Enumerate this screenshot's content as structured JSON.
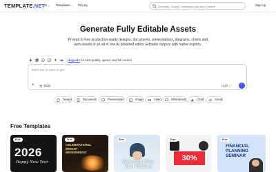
{
  "nav": {
    "logo": "TEMPLATE",
    "logo_suffix": ".NET",
    "ai_label": "AI",
    "templates_label": "Templates",
    "pricing_label": "Pricing",
    "search_placeholder": "Generate, Search Templates with your Content",
    "signup_label": "Sign up"
  },
  "hero": {
    "title": "Generate Fully Editable Assets",
    "subtitle": "Prompt to free production-ready designs, documents, presentations, diagrams, charts and web assets in an all in one AI powered editor. Editable outputs with native exports."
  },
  "prompt": {
    "upgrade_link": "Upgrade",
    "upgrade_text": " for best quality, speed, and full control",
    "placeholder": "Enter text or voice to gen",
    "add_label": "+",
    "tools_label": "Tools",
    "mode_label": "Light ⌄",
    "send_icon": "↑"
  },
  "chips": [
    {
      "label": "Design",
      "icon": "palette-icon"
    },
    {
      "label": "Document",
      "icon": "document-icon"
    },
    {
      "label": "Presentation",
      "icon": "presentation-icon"
    },
    {
      "label": "Image",
      "icon": "image-icon"
    },
    {
      "label": "Video",
      "icon": "video-icon"
    },
    {
      "label": "Whiteboard",
      "icon": "whiteboard-icon"
    },
    {
      "label": "Chart",
      "icon": "chart-icon"
    },
    {
      "label": "Social",
      "icon": "social-icon"
    }
  ],
  "section": {
    "title": "Free Templates"
  },
  "cards": [
    {
      "badge": "Free",
      "year": "2026",
      "line": "Happy New Year"
    },
    {
      "badge": "Free",
      "lines": [
        "Celebrations,",
        "Bright",
        "Beginnings!"
      ]
    },
    {
      "badge": "Free",
      "lines": [
        "Heartfelt New",
        "Year Wishes"
      ]
    },
    {
      "badge": "Free",
      "sale": "30%"
    },
    {
      "badge": "Free",
      "lines": [
        "FINANCIAL",
        "PLANNING",
        "SEMINAR"
      ]
    }
  ],
  "colors": {
    "accent": "#3b5bff",
    "send_button": "#3d56f5",
    "sale_red": "#ef2b3a"
  }
}
